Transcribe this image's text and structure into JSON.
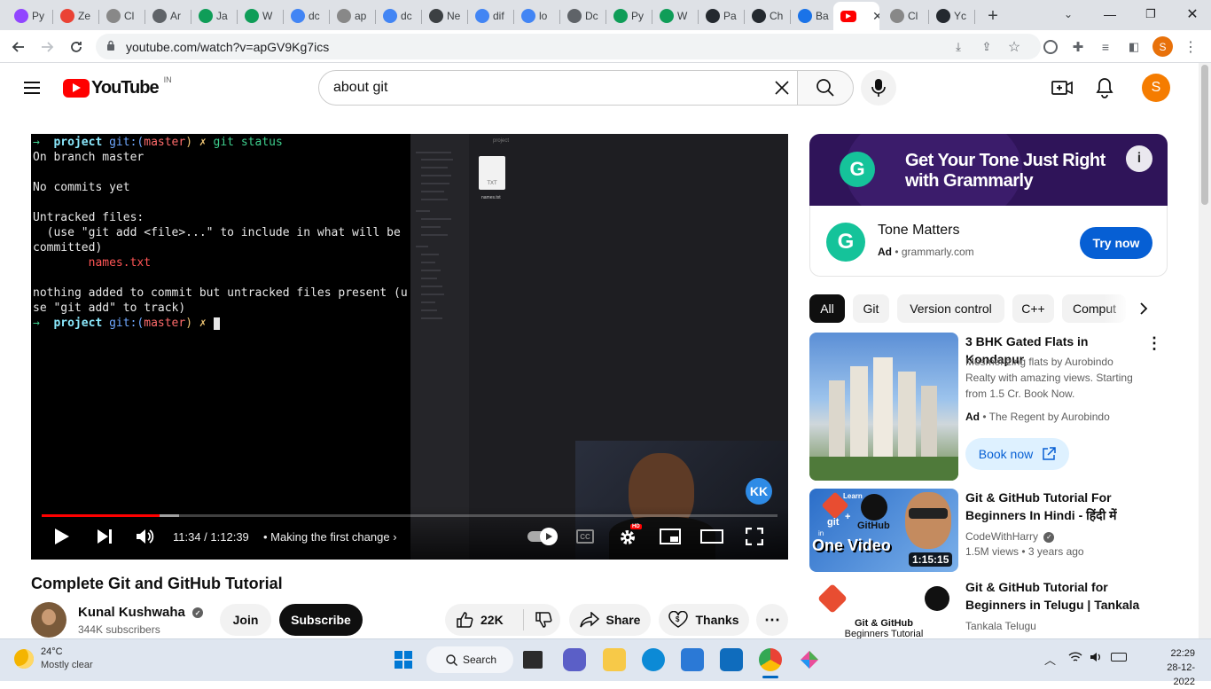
{
  "browser": {
    "tabs": [
      {
        "label": "Py",
        "color": "#9146ff"
      },
      {
        "label": "Ze",
        "color": "#ea4335"
      },
      {
        "label": "Cl",
        "color": "#888888"
      },
      {
        "label": "Ar",
        "color": "#5f6368"
      },
      {
        "label": "Ja",
        "color": "#0f9d58"
      },
      {
        "label": "W",
        "color": "#0f9d58"
      },
      {
        "label": "dc",
        "color": "#4285f4"
      },
      {
        "label": "ap",
        "color": "#888888"
      },
      {
        "label": "dc",
        "color": "#4285f4"
      },
      {
        "label": "Ne",
        "color": "#3c4043"
      },
      {
        "label": "dif",
        "color": "#4285f4"
      },
      {
        "label": "lo",
        "color": "#4285f4"
      },
      {
        "label": "Dc",
        "color": "#5f6368"
      },
      {
        "label": "Py",
        "color": "#0f9d58"
      },
      {
        "label": "W",
        "color": "#0f9d58"
      },
      {
        "label": "Pa",
        "color": "#24292f"
      },
      {
        "label": "Ch",
        "color": "#24292f"
      },
      {
        "label": "Ba",
        "color": "#1a73e8"
      },
      {
        "label": "",
        "color": "#ff0000"
      },
      {
        "label": "Cl",
        "color": "#888888"
      },
      {
        "label": "Yc",
        "color": "#24292f"
      }
    ],
    "url": "youtube.com/watch?v=apGV9Kg7ics",
    "profile_initial": "S"
  },
  "youtube": {
    "logo_text": "YouTube",
    "region": "IN",
    "search_value": "about git",
    "avatar_initial": "S"
  },
  "player": {
    "terminal_lines": [
      {
        "text": "→  project git:(master) ✗ git status",
        "prompt": true
      },
      {
        "text": "On branch master"
      },
      {
        "text": ""
      },
      {
        "text": "No commits yet"
      },
      {
        "text": ""
      },
      {
        "text": "Untracked files:"
      },
      {
        "text": "  (use \"git add <file>...\" to include in what will be"
      },
      {
        "text": "committed)"
      },
      {
        "text": "        names.txt",
        "red": true
      },
      {
        "text": ""
      },
      {
        "text": "nothing added to commit but untracked files present (u"
      },
      {
        "text": "se \"git add\" to track)"
      },
      {
        "text": "→  project git:(master) ✗ ",
        "prompt": true,
        "cursor": true
      }
    ],
    "finder_title": "project",
    "finder_file": "names.txt",
    "finder_file_ext": "TXT",
    "watermark": "KK",
    "hd_badge": "HD",
    "time": "11:34 / 1:12:39",
    "chapter": "Making the first change",
    "progress_fraction": 0.16
  },
  "video": {
    "title": "Complete Git and GitHub Tutorial",
    "channel": "Kunal Kushwaha",
    "subscribers": "344K subscribers",
    "join": "Join",
    "subscribe": "Subscribe",
    "likes": "22K",
    "share": "Share",
    "thanks": "Thanks"
  },
  "ad": {
    "banner_line1": "Get Your Tone Just Right",
    "banner_line2": "with Grammarly",
    "title": "Tone Matters",
    "badge": "Ad",
    "domain": "grammarly.com",
    "cta": "Try now"
  },
  "chips": [
    "All",
    "Git",
    "Version control",
    "C++",
    "Comput"
  ],
  "recommendations": [
    {
      "title": "3 BHK Gated Flats in Kondapur",
      "desc1": "Mesmerizing flats by Aurobindo",
      "desc2": "Realty with amazing views. Starting",
      "desc3": "from 1.5 Cr. Book Now.",
      "badge": "Ad",
      "advertiser": "The Regent by Aurobindo",
      "cta": "Book now"
    },
    {
      "title_line1": "Git & GitHub Tutorial For",
      "title_line2": "Beginners In Hindi - हिंदी में",
      "channel": "CodeWithHarry",
      "meta": "1.5M views  •  3 years ago",
      "duration": "1:15:15",
      "thumb_text": "One Video",
      "thumb_learn": "Learn",
      "thumb_git": "git",
      "thumb_github": "GitHub",
      "thumb_in": "in"
    },
    {
      "title_line1": "Git & GitHub Tutorial for",
      "title_line2": "Beginners in Telugu | Tankala",
      "channel": "Tankala Telugu",
      "thumb_text1": "Git & GitHub",
      "thumb_text2": "Beginners Tutorial"
    }
  ],
  "taskbar": {
    "temp": "24°C",
    "weather": "Mostly clear",
    "search": "Search",
    "time": "22:29",
    "date": "28-12-2022"
  }
}
